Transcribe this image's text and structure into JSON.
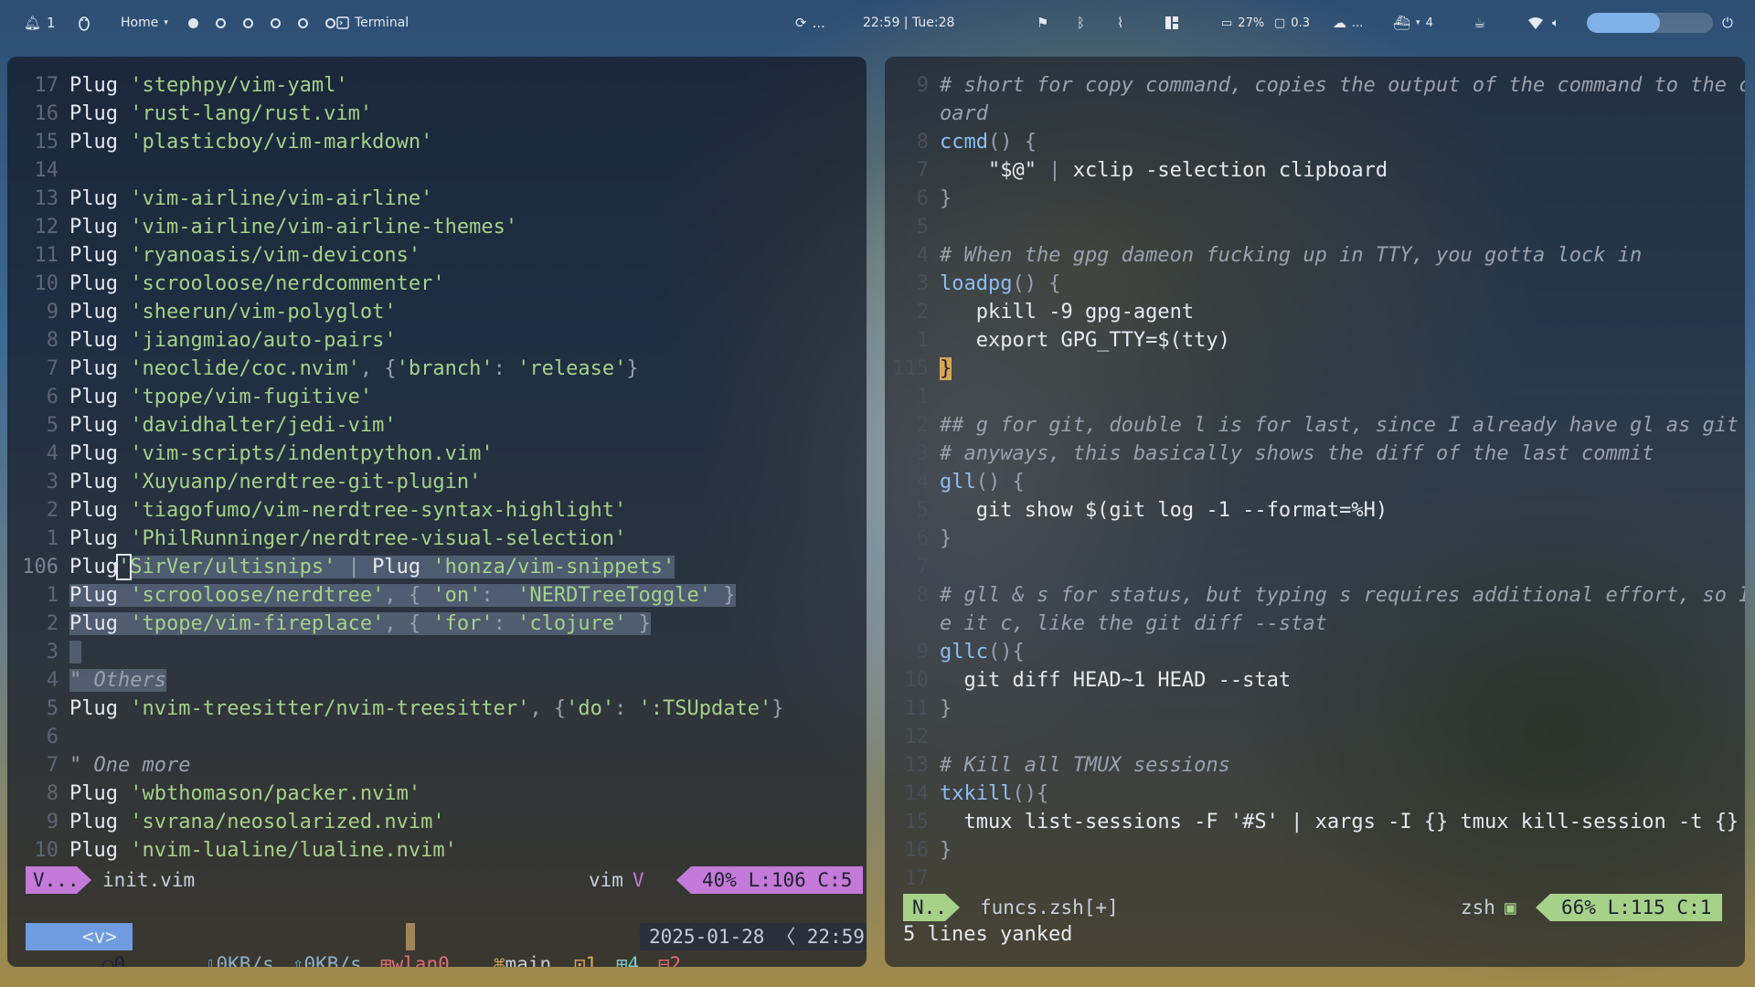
{
  "topbar": {
    "notifications": "1",
    "home_label": "Home",
    "workspaces": [
      true,
      false,
      false,
      false,
      false,
      false
    ],
    "terminal_label": "Terminal",
    "refresh_label": "...",
    "clock": "22:59 | Tue:28",
    "battery": "27%",
    "cpu": "0.3",
    "cloud": "...",
    "docker_count": "4",
    "volume_level": 0.58
  },
  "left": {
    "lines": [
      {
        "n": "17",
        "t": [
          [
            "kw",
            "Plug "
          ],
          [
            "str",
            "'stephpy/vim-yaml'"
          ]
        ]
      },
      {
        "n": "16",
        "t": [
          [
            "kw",
            "Plug "
          ],
          [
            "str",
            "'rust-lang/rust.vim'"
          ]
        ]
      },
      {
        "n": "15",
        "t": [
          [
            "kw",
            "Plug "
          ],
          [
            "str",
            "'plasticboy/vim-markdown'"
          ]
        ]
      },
      {
        "n": "14",
        "t": []
      },
      {
        "n": "13",
        "t": [
          [
            "kw",
            "Plug "
          ],
          [
            "str",
            "'vim-airline/vim-airline'"
          ]
        ]
      },
      {
        "n": "12",
        "t": [
          [
            "kw",
            "Plug "
          ],
          [
            "str",
            "'vim-airline/vim-airline-themes'"
          ]
        ]
      },
      {
        "n": "11",
        "t": [
          [
            "kw",
            "Plug "
          ],
          [
            "str",
            "'ryanoasis/vim-devicons'"
          ]
        ]
      },
      {
        "n": "10",
        "t": [
          [
            "kw",
            "Plug "
          ],
          [
            "str",
            "'scrooloose/nerdcommenter'"
          ]
        ]
      },
      {
        "n": "9",
        "t": [
          [
            "kw",
            "Plug "
          ],
          [
            "str",
            "'sheerun/vim-polyglot'"
          ]
        ]
      },
      {
        "n": "8",
        "t": [
          [
            "kw",
            "Plug "
          ],
          [
            "str",
            "'jiangmiao/auto-pairs'"
          ]
        ]
      },
      {
        "n": "7",
        "t": [
          [
            "kw",
            "Plug "
          ],
          [
            "str",
            "'neoclide/coc.nvim'"
          ],
          [
            "punc",
            ", {"
          ],
          [
            "str",
            "'branch'"
          ],
          [
            "punc",
            ": "
          ],
          [
            "str",
            "'release'"
          ],
          [
            "punc",
            "}"
          ]
        ]
      },
      {
        "n": "6",
        "t": [
          [
            "kw",
            "Plug "
          ],
          [
            "str",
            "'tpope/vim-fugitive'"
          ]
        ]
      },
      {
        "n": "5",
        "t": [
          [
            "kw",
            "Plug "
          ],
          [
            "str",
            "'davidhalter/jedi-vim'"
          ]
        ]
      },
      {
        "n": "4",
        "t": [
          [
            "kw",
            "Plug "
          ],
          [
            "str",
            "'vim-scripts/indentpython.vim'"
          ]
        ]
      },
      {
        "n": "3",
        "t": [
          [
            "kw",
            "Plug "
          ],
          [
            "str",
            "'Xuyuanp/nerdtree-git-plugin'"
          ]
        ]
      },
      {
        "n": "2",
        "t": [
          [
            "kw",
            "Plug "
          ],
          [
            "str",
            "'tiagofumo/vim-nerdtree-syntax-highlight'"
          ]
        ]
      },
      {
        "n": "1",
        "t": [
          [
            "kw",
            "Plug "
          ],
          [
            "str",
            "'PhilRunninger/nerdtree-visual-selection'"
          ]
        ]
      },
      {
        "n": "106",
        "cur": true,
        "t": [
          [
            "kw",
            "Plug"
          ],
          [
            "cursor",
            "'"
          ],
          [
            "sel-str",
            "SirVer/ultisnips'"
          ],
          [
            "sel",
            " | "
          ],
          [
            "sel-kw",
            "Plug "
          ],
          [
            "sel-str",
            "'honza/vim-snippets'"
          ]
        ]
      },
      {
        "n": "1",
        "t": [
          [
            "sel-kw",
            "Plug "
          ],
          [
            "sel-str",
            "'scrooloose/nerdtree'"
          ],
          [
            "sel",
            ", { "
          ],
          [
            "sel-str",
            "'on'"
          ],
          [
            "sel",
            ":  "
          ],
          [
            "sel-str",
            "'NERDTreeToggle'"
          ],
          [
            "sel",
            " }"
          ]
        ]
      },
      {
        "n": "2",
        "t": [
          [
            "sel-kw",
            "Plug "
          ],
          [
            "sel-str",
            "'tpope/vim-fireplace'"
          ],
          [
            "sel",
            ", { "
          ],
          [
            "sel-str",
            "'for'"
          ],
          [
            "sel",
            ": "
          ],
          [
            "sel-str",
            "'clojure'"
          ],
          [
            "sel",
            " }"
          ]
        ]
      },
      {
        "n": "3",
        "t": [
          [
            "sel",
            " "
          ]
        ]
      },
      {
        "n": "4",
        "t": [
          [
            "sel-comment",
            "\" Others"
          ]
        ]
      },
      {
        "n": "5",
        "t": [
          [
            "kw",
            "Plug "
          ],
          [
            "str",
            "'nvim-treesitter/nvim-treesitter'"
          ],
          [
            "punc",
            ", {"
          ],
          [
            "str",
            "'do'"
          ],
          [
            "punc",
            ": "
          ],
          [
            "str",
            "':TSUpdate'"
          ],
          [
            "punc",
            "}"
          ]
        ]
      },
      {
        "n": "6",
        "t": []
      },
      {
        "n": "7",
        "t": [
          [
            "comment",
            "\" One more"
          ]
        ]
      },
      {
        "n": "8",
        "t": [
          [
            "kw",
            "Plug "
          ],
          [
            "str",
            "'wbthomason/packer.nvim'"
          ]
        ]
      },
      {
        "n": "9",
        "t": [
          [
            "kw",
            "Plug "
          ],
          [
            "str",
            "'svrana/neosolarized.nvim'"
          ]
        ]
      },
      {
        "n": "10",
        "t": [
          [
            "kw",
            "Plug "
          ],
          [
            "str",
            "'nvim-lualine/lualine.nvim'"
          ]
        ]
      }
    ],
    "status": {
      "mode": "V...",
      "file": "init.vim",
      "filetype": "vim",
      "position": "40% L:106 C:5"
    },
    "tmux": {
      "session": "0",
      "prefix": "<v>",
      "down": "0KB/s",
      "up": "0KB/s",
      "iface": "wlan0",
      "branch": "main",
      "w1": "1",
      "plus": "4",
      "minus": "2",
      "datetime": "2025-01-28 〈 22:59"
    }
  },
  "right": {
    "lines": [
      {
        "n": "9",
        "t": [
          [
            "comment",
            "# short for copy command, copies the output of the command to the clipb"
          ]
        ]
      },
      {
        "n": "",
        "t": [
          [
            "comment",
            "oard"
          ]
        ]
      },
      {
        "n": "8",
        "t": [
          [
            "fn",
            "ccmd"
          ],
          [
            "punc",
            "() {"
          ]
        ]
      },
      {
        "n": "7",
        "t": [
          [
            "var",
            "    \"$@\" "
          ],
          [
            "punc",
            "| "
          ],
          [
            "cmd",
            "xclip -selection clipboard"
          ]
        ]
      },
      {
        "n": "6",
        "t": [
          [
            "punc",
            "}"
          ]
        ]
      },
      {
        "n": "5",
        "t": []
      },
      {
        "n": "4",
        "t": [
          [
            "comment",
            "# When the gpg dameon fucking up in TTY, you gotta lock in"
          ]
        ]
      },
      {
        "n": "3",
        "t": [
          [
            "fn",
            "loadpg"
          ],
          [
            "punc",
            "() "
          ],
          [
            "brace",
            "{"
          ]
        ]
      },
      {
        "n": "2",
        "t": [
          [
            "cmd",
            "   pkill -9 gpg-agent"
          ]
        ]
      },
      {
        "n": "1",
        "t": [
          [
            "cmd",
            "   export GPG_TTY=$(tty)"
          ]
        ]
      },
      {
        "n": "115",
        "cur": true,
        "t": [
          [
            "brace-hl",
            "}"
          ]
        ]
      },
      {
        "n": "1",
        "t": []
      },
      {
        "n": "2",
        "t": [
          [
            "comment",
            "## g for git, double l is for last, since I already have gl as git log."
          ]
        ]
      },
      {
        "n": "3",
        "t": [
          [
            "comment",
            "# anyways, this basically shows the diff of the last commit"
          ]
        ]
      },
      {
        "n": "4",
        "t": [
          [
            "fn",
            "gll"
          ],
          [
            "punc",
            "() {"
          ]
        ]
      },
      {
        "n": "5",
        "t": [
          [
            "cmd",
            "   git show $(git log -1 --format=%H)"
          ]
        ]
      },
      {
        "n": "6",
        "t": [
          [
            "punc",
            "}"
          ]
        ]
      },
      {
        "n": "7",
        "t": []
      },
      {
        "n": "8",
        "t": [
          [
            "comment",
            "# gll & s for status, but typing s requires additional effort, so I mad"
          ]
        ]
      },
      {
        "n": "",
        "t": [
          [
            "comment",
            "e it c, like the git diff --stat"
          ]
        ]
      },
      {
        "n": "9",
        "t": [
          [
            "fn",
            "gllc"
          ],
          [
            "punc",
            "(){"
          ]
        ]
      },
      {
        "n": "10",
        "t": [
          [
            "cmd",
            "  git diff HEAD~1 HEAD --stat"
          ]
        ]
      },
      {
        "n": "11",
        "t": [
          [
            "punc",
            "}"
          ]
        ]
      },
      {
        "n": "12",
        "t": []
      },
      {
        "n": "13",
        "t": [
          [
            "comment",
            "# Kill all TMUX sessions"
          ]
        ]
      },
      {
        "n": "14",
        "t": [
          [
            "fn",
            "txkill"
          ],
          [
            "punc",
            "(){"
          ]
        ]
      },
      {
        "n": "15",
        "t": [
          [
            "cmd",
            "  tmux list-sessions -F '#S' | xargs -I {} tmux kill-session -t {}"
          ]
        ]
      },
      {
        "n": "16",
        "t": [
          [
            "punc",
            "}"
          ]
        ]
      },
      {
        "n": "17",
        "t": []
      }
    ],
    "status": {
      "mode": "N...",
      "file": "funcs.zsh[+]",
      "filetype": "zsh",
      "position": "66% L:115 C:1"
    },
    "message": "5 lines yanked"
  },
  "colors": {
    "visual_mode": "#c37ad8",
    "normal_mode": "#a6d189",
    "string": "#a6d189",
    "tmux_session": "#6f9ce0",
    "tmux_net": "#6fb0e0",
    "tmux_iface": "#e06c75",
    "tmux_branch": "#d8a657"
  }
}
